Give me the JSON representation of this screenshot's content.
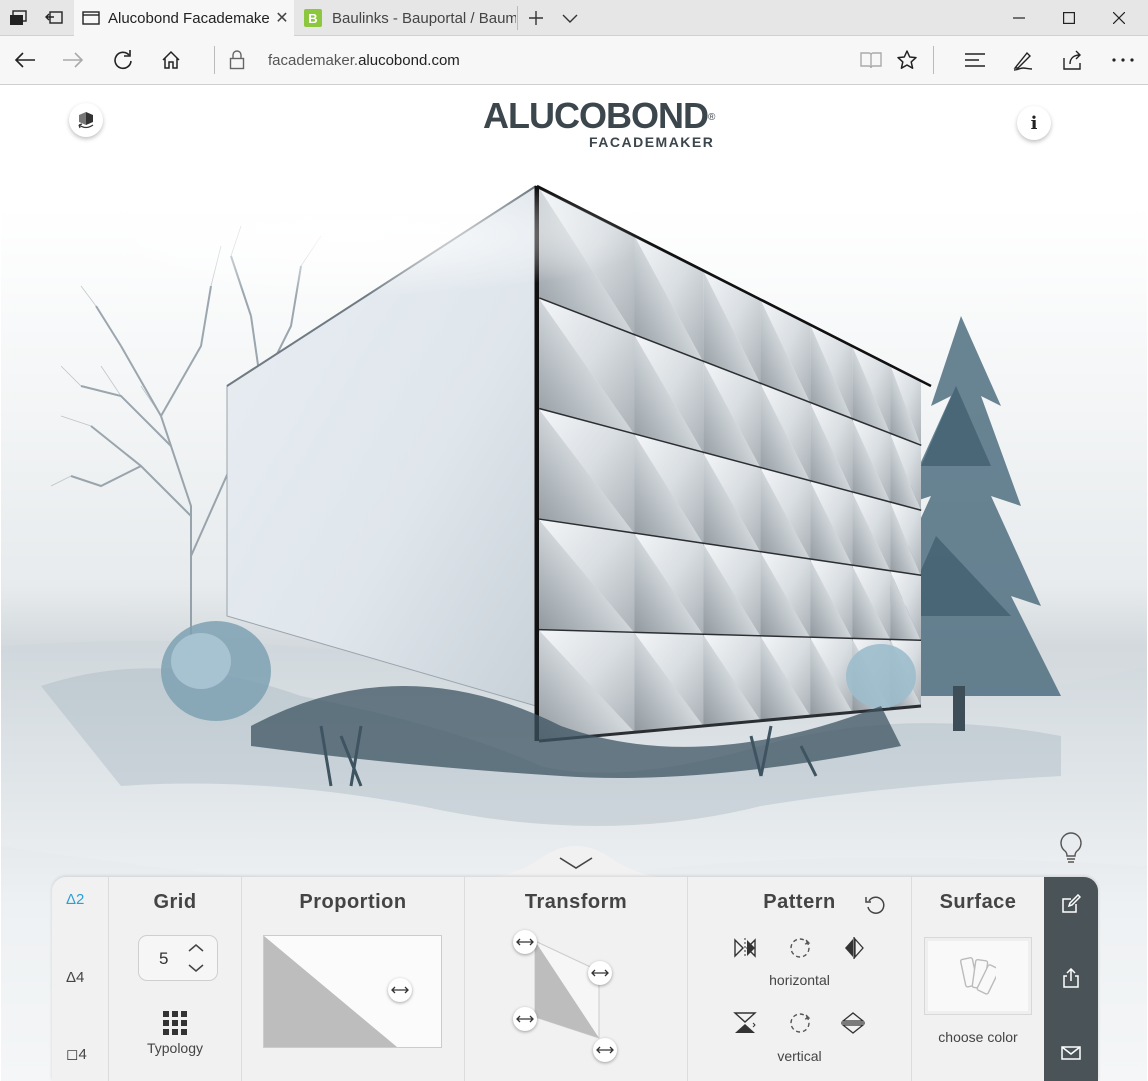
{
  "browser": {
    "tabs": [
      {
        "title": "Alucobond Facademake",
        "active": true
      },
      {
        "title": "Baulinks - Bauportal / Baum",
        "active": false,
        "favicon_letter": "B"
      }
    ],
    "url": {
      "prefix": "facademaker.",
      "host": "alucobond.com"
    }
  },
  "app": {
    "logo": {
      "brand": "ALUCOBOND",
      "registered": "®",
      "product": "FACADEMAKER"
    },
    "info_button": "i"
  },
  "toolbar": {
    "triangle_options": [
      {
        "label": "Δ2",
        "active": true
      },
      {
        "label": "Δ4",
        "active": false
      },
      {
        "label": "◻4",
        "active": false
      }
    ],
    "grid": {
      "title": "Grid",
      "value": "5",
      "typology_label": "Typology"
    },
    "proportion": {
      "title": "Proportion"
    },
    "transform": {
      "title": "Transform"
    },
    "pattern": {
      "title": "Pattern",
      "horizontal_label": "horizontal",
      "vertical_label": "vertical"
    },
    "surface": {
      "title": "Surface",
      "choose_color_label": "choose color"
    }
  },
  "colors": {
    "accent": "#2a9fd6",
    "sidebar": "#4a5358",
    "logo": "#3c464d"
  },
  "icons": [
    "back-icon",
    "forward-icon",
    "refresh-icon",
    "home-icon",
    "lock-icon",
    "reading-view-icon",
    "favorite-star-icon",
    "hub-icon",
    "pen-icon",
    "share-icon",
    "more-icon",
    "rotate-view-icon",
    "lightbulb-icon",
    "chevron-down-icon",
    "reset-icon",
    "edit-icon",
    "export-icon",
    "mail-icon"
  ]
}
